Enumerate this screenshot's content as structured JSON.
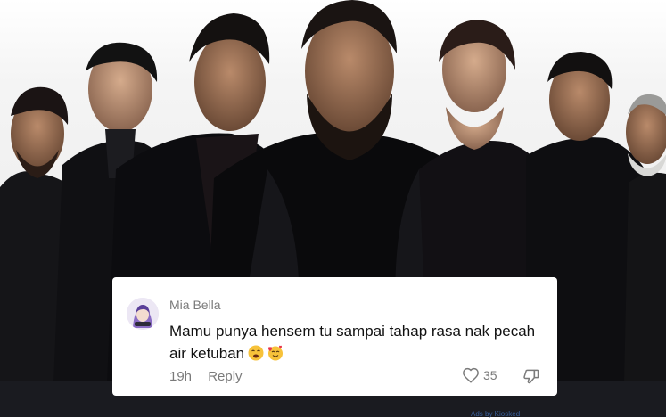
{
  "comment": {
    "username": "Mia Bella",
    "text": "Mamu punya hensem tu sampai tahap rasa nak pecah air ketuban",
    "emojis": [
      "weary-face-emoji",
      "smiling-face-with-hearts-emoji"
    ],
    "time": "19h",
    "reply_label": "Reply",
    "like_count": "35",
    "icons": {
      "like": "heart-outline-icon",
      "dislike": "thumbs-down-outline-icon",
      "avatar": "anime-girl-avatar"
    }
  },
  "footer": {
    "ads_text": "Ads by Kiosked"
  },
  "colors": {
    "card_bg": "#ffffff",
    "text_primary": "#111111",
    "text_secondary": "#7a7a7a",
    "strip_bg": "#1a1b20",
    "ads_link": "#3a5f9a"
  }
}
